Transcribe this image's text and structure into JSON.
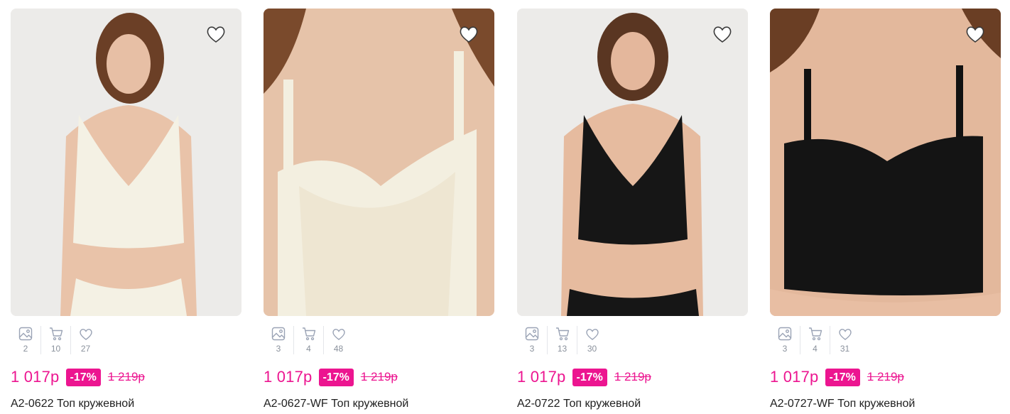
{
  "products": [
    {
      "name": "A2-0622 Топ кружевной",
      "price": "1 017р",
      "discount": "-17%",
      "old_price": "1 219р",
      "stats": {
        "photos": "2",
        "in_cart": "10",
        "favorites": "27"
      },
      "favorited": false,
      "garment_color": "ivory"
    },
    {
      "name": "A2-0627-WF Топ кружевной",
      "price": "1 017р",
      "discount": "-17%",
      "old_price": "1 219р",
      "stats": {
        "photos": "3",
        "in_cart": "4",
        "favorites": "48"
      },
      "favorited": false,
      "garment_color": "ivory"
    },
    {
      "name": "A2-0722 Топ кружевной",
      "price": "1 017р",
      "discount": "-17%",
      "old_price": "1 219р",
      "stats": {
        "photos": "3",
        "in_cart": "13",
        "favorites": "30"
      },
      "favorited": false,
      "garment_color": "black"
    },
    {
      "name": "A2-0727-WF Топ кружевной",
      "price": "1 017р",
      "discount": "-17%",
      "old_price": "1 219р",
      "stats": {
        "photos": "3",
        "in_cart": "4",
        "favorites": "31"
      },
      "favorited": false,
      "garment_color": "black"
    }
  ],
  "icons": {
    "photos": "image-icon",
    "in_cart": "cart-icon",
    "favorites": "heart-icon",
    "favorite_toggle": "heart-outline-icon"
  },
  "colors": {
    "accent": "#ec1590",
    "stat_icon": "#9aa3b5",
    "stat_text": "#8a919c",
    "card_background": "#eceae8"
  }
}
